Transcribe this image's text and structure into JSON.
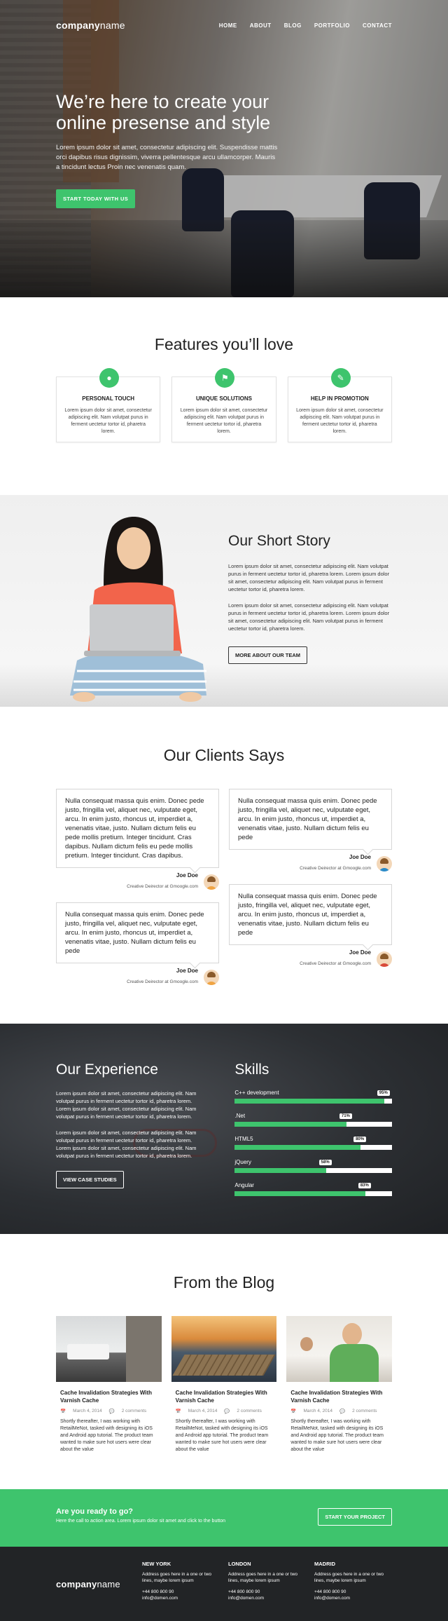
{
  "nav": {
    "logo_bold": "company",
    "logo_light": "name",
    "items": [
      "HOME",
      "ABOUT",
      "BLOG",
      "PORTFOLIO",
      "CONTACT"
    ]
  },
  "hero": {
    "title_line1": "We’re here to create your",
    "title_line2": "online presense and style",
    "text": "Lorem ipsum dolor sit amet, consectetur adipiscing elit. Suspendisse mattis orci dapibus risus dignissim, viverra pellentesque arcu ullamcorper. Mauris a tincidunt lectus Proin nec venenatis quam.",
    "cta": "START TODAY WITH US"
  },
  "features": {
    "title": "Features you’ll love",
    "items": [
      {
        "icon": "person-icon",
        "title": "PERSONAL TOUCH",
        "text": "Lorem ipsum dolor sit amet, consectetur adipiscing elit. Nam volutpat purus in ferment uectetur tortor id, pharetra lorem."
      },
      {
        "icon": "flag-icon",
        "title": "UNIQUE SOLUTIONS",
        "text": "Lorem ipsum dolor sit amet, consectetur adipiscing elit. Nam volutpat purus in ferment uectetur tortor id, pharetra lorem."
      },
      {
        "icon": "pencil-icon",
        "title": "HELP IN PROMOTION",
        "text": "Lorem ipsum dolor sit amet, consectetur adipiscing elit. Nam volutpat purus in ferment uectetur tortor id, pharetra lorem."
      }
    ]
  },
  "story": {
    "title": "Our Short Story",
    "p1": "Lorem ipsum dolor sit amet, consectetur adipiscing elit. Nam volutpat purus in ferment uectetur tortor id, pharetra lorem. Lorem ipsum dolor sit amet, consectetur adipiscing elit. Nam volutpat purus in ferment uectetur tortor id, pharetra lorem.",
    "p2": "Lorem ipsum dolor sit amet, consectetur adipiscing elit. Nam volutpat purus in ferment uectetur tortor id, pharetra lorem. Lorem ipsum dolor sit amet, consectetur adipiscing elit. Nam volutpat purus in ferment uectetur tortor id, pharetra lorem.",
    "button": "MORE ABOUT OUR TEAM"
  },
  "clients": {
    "title": "Our Clients Says",
    "left": [
      {
        "text": "Nulla consequat massa quis enim. Donec pede justo, fringilla vel, aliquet nec, vulputate eget, arcu. In enim justo, rhoncus ut, imperdiet a, venenatis vitae, justo. Nullam dictum felis eu pede mollis pretium. Integer tincidunt. Cras dapibus. Nullam dictum felis eu pede mollis pretium. Integer tincidunt. Cras dapibus.",
        "name": "Joe Doe",
        "role": "Creative Deirector at Gmoogle.com"
      },
      {
        "text": "Nulla consequat massa quis enim. Donec pede justo, fringilla vel, aliquet nec, vulputate eget, arcu. In enim justo, rhoncus ut, imperdiet a, venenatis vitae, justo. Nullam dictum felis eu pede",
        "name": "Joe Doe",
        "role": "Creative Deirector at Gmoogle.com"
      }
    ],
    "right": [
      {
        "text": "Nulla consequat massa quis enim. Donec pede justo, fringilla vel, aliquet nec, vulputate eget, arcu. In enim justo, rhoncus ut, imperdiet a, venenatis vitae, justo. Nullam dictum felis eu pede",
        "name": "Joe Doe",
        "role": "Creative Deirector at Gmoogle.com"
      },
      {
        "text": "Nulla consequat massa quis enim. Donec pede justo, fringilla vel, aliquet nec, vulputate eget, arcu. In enim justo, rhoncus ut, imperdiet a, venenatis vitae, justo. Nullam dictum felis eu pede",
        "name": "Joe Doe",
        "role": "Creative Deirector at Gmoogle.com"
      }
    ]
  },
  "experience": {
    "title": "Our Experience",
    "p1": "Lorem ipsum dolor sit amet, consectetur adipiscing elit. Nam volutpat purus in ferment uectetur tortor id, pharetra lorem. Lorem ipsum dolor sit amet, consectetur adipiscing elit. Nam volutpat purus in ferment uectetur tortor id, pharetra lorem.",
    "p2": "Lorem ipsum dolor sit amet, consectetur adipiscing elit. Nam volutpat purus in ferment uectetur tortor id, pharetra lorem. Lorem ipsum dolor sit amet, consectetur adipiscing elit. Nam volutpat purus in ferment uectetur tortor id, pharetra lorem.",
    "button": "VIEW CASE STUDIES",
    "skills_title": "Skills",
    "skills": [
      {
        "name": "C++ development",
        "pct": 95,
        "label": "95%"
      },
      {
        "name": ".Net",
        "pct": 71,
        "label": "71%"
      },
      {
        "name": "HTML5",
        "pct": 80,
        "label": "80%"
      },
      {
        "name": "jQuery",
        "pct": 58,
        "label": "58%"
      },
      {
        "name": "Angular",
        "pct": 83,
        "label": "83%"
      }
    ]
  },
  "blog": {
    "title": "From the Blog",
    "posts": [
      {
        "title": "Cache Invalidation Strategies With Varnish Cache",
        "date": "March 4, 2014",
        "comments": "2 comments",
        "text": "Shortly thereafter, I was working with RetailMeNot, tasked with designing its iOS and Android app tutorial. The product team wanted to make sure hot users were clear about the value"
      },
      {
        "title": "Cache Invalidation Strategies With Varnish Cache",
        "date": "March 4, 2014",
        "comments": "2 comments",
        "text": "Shortly thereafter, I was working with RetailMeNot, tasked with designing its iOS and Android app tutorial. The product team wanted to make sure hot users were clear about the value"
      },
      {
        "title": "Cache Invalidation Strategies With Varnish Cache",
        "date": "March 4, 2014",
        "comments": "2 comments",
        "text": "Shortly thereafter, I was working with RetailMeNot, tasked with designing its iOS and Android app tutorial. The product team wanted to make sure hot users were clear about the value"
      }
    ]
  },
  "cta": {
    "title": "Are you ready to go?",
    "text": "Here the call to action area. Lorem ipsum dolor sit amet and click to the button",
    "button": "START YOUR PROJECT"
  },
  "footer": {
    "logo_bold": "company",
    "logo_light": "name",
    "offices": [
      {
        "city": "NEW YORK",
        "address": "Address goes here in a one or two lines, maybe lorem ipsum",
        "phone": "+44 800 800 90",
        "email": "info@domen.com"
      },
      {
        "city": "LONDON",
        "address": "Address goes here in a one or two lines, maybe lorem ipsum",
        "phone": "+44 800 800 90",
        "email": "info@domen.com"
      },
      {
        "city": "MADRID",
        "address": "Address goes here in a one or two lines, maybe lorem ipsum",
        "phone": "+44 800 800 90",
        "email": "info@domen.com"
      }
    ]
  },
  "colors": {
    "accent": "#3ec46d",
    "dark": "#222426"
  }
}
